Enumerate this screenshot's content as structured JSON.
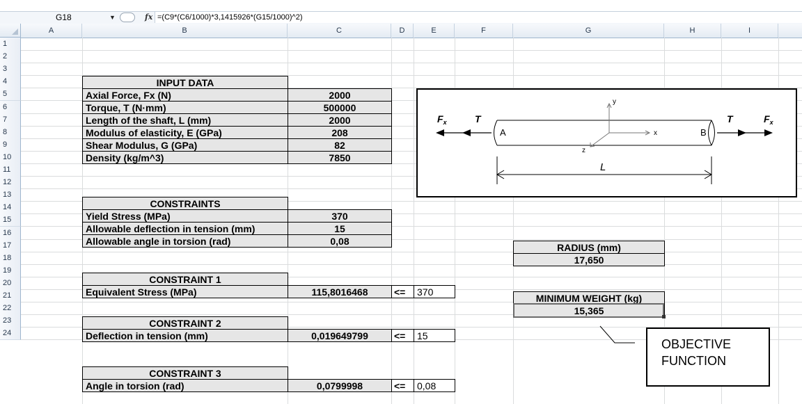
{
  "formula_bar": {
    "name_box": "G18",
    "fx": "fx",
    "formula": "=(C9*(C6/1000)*3,1415926*(G15/1000)^2)"
  },
  "columns": [
    "A",
    "B",
    "C",
    "D",
    "E",
    "F",
    "G",
    "H",
    "I"
  ],
  "rows": [
    "1",
    "2",
    "3",
    "4",
    "5",
    "6",
    "7",
    "8",
    "9",
    "10",
    "11",
    "12",
    "13",
    "14",
    "15",
    "16",
    "17",
    "18",
    "19",
    "20",
    "21",
    "22",
    "23",
    "24"
  ],
  "input_data": {
    "title": "INPUT DATA",
    "items": [
      {
        "label": "Axial Force, Fx (N)",
        "value": "2000"
      },
      {
        "label": "Torque, T (N·mm)",
        "value": "500000"
      },
      {
        "label": "Length of the shaft, L (mm)",
        "value": "2000"
      },
      {
        "label": "Modulus of elasticity, E (GPa)",
        "value": "208"
      },
      {
        "label": "Shear Modulus, G (GPa)",
        "value": "82"
      },
      {
        "label": "Density (kg/m^3)",
        "value": "7850"
      }
    ]
  },
  "constraints": {
    "title": "CONSTRAINTS",
    "items": [
      {
        "label": "Yield Stress (MPa)",
        "value": "370"
      },
      {
        "label": "Allowable deflection in tension (mm)",
        "value": "15"
      },
      {
        "label": "Allowable angle in torsion (rad)",
        "value": "0,08"
      }
    ]
  },
  "constraint1": {
    "title": "CONSTRAINT 1",
    "label": "Equivalent Stress (MPa)",
    "value": "115,8016468",
    "op": "<=",
    "limit": "370"
  },
  "constraint2": {
    "title": "CONSTRAINT 2",
    "label": "Deflection in tension (mm)",
    "value": "0,019649799",
    "op": "<=",
    "limit": "15"
  },
  "constraint3": {
    "title": "CONSTRAINT 3",
    "label": "Angle in torsion (rad)",
    "value": "0,0799998",
    "op": "<=",
    "limit": "0,08"
  },
  "radius": {
    "title": "RADIUS (mm)",
    "value": "17,650"
  },
  "min_weight": {
    "title": "MINIMUM WEIGHT (kg)",
    "value": "15,365"
  },
  "callout": {
    "line1": "OBJECTIVE",
    "line2": "FUNCTION"
  },
  "diagram": {
    "fx_left": "F",
    "fx_sub": "x",
    "t_left": "T",
    "a": "A",
    "b": "B",
    "t_right": "T",
    "fx_right": "F",
    "axis_x": "x",
    "axis_y": "y",
    "axis_z": "z",
    "length": "L"
  }
}
